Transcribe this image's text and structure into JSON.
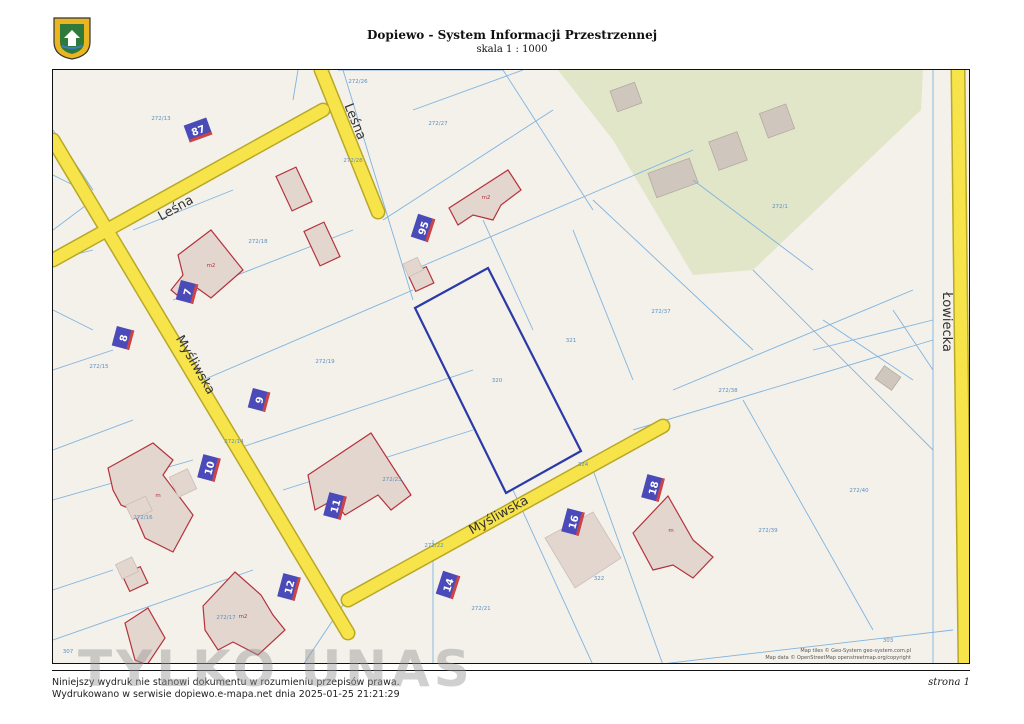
{
  "header": {
    "title": "Dopiewo - System Informacji Przestrzennej",
    "scale": "skala 1 : 1000"
  },
  "map": {
    "streets": [
      "Leśna",
      "Leśna",
      "Myśliwska",
      "Myśliwska",
      "Łowiecka"
    ],
    "address_numbers": [
      "87",
      "95",
      "7",
      "8",
      "9",
      "10",
      "11",
      "12",
      "14",
      "16",
      "18"
    ],
    "parcel_ids": [
      "272/26",
      "272/13",
      "272/27",
      "272/28",
      "272/18",
      "272/1",
      "272/15",
      "272/19",
      "321",
      "320",
      "272/37",
      "272/38",
      "272/14",
      "272/23",
      "272/40",
      "272/16",
      "272/22",
      "324",
      "272/39",
      "272/17",
      "272/21",
      "322",
      "307",
      "303"
    ],
    "building_labels": [
      "m2",
      "m2",
      "m",
      "m2",
      "m"
    ],
    "attribution": [
      "Map tiles © Geo-System geo-system.com.pl",
      "Map data © OpenStreetMap openstreetmap.org/copyright"
    ],
    "colors": {
      "background": "#f4f1ea",
      "road_fill": "#f7e34a",
      "road_casing": "#b9a826",
      "parcel_line": "#7fb4e0",
      "building_outline": "#b5323c",
      "building_fill": "#e2d6cf",
      "address_badge": "#4a4ab8",
      "highlight": "#2a3aa8",
      "green_area": "#e2e6c8"
    }
  },
  "footer": {
    "line1": "Niniejszy wydruk nie stanowi dokumentu w rozumieniu przepisów prawa.",
    "line2": "Wydrukowano w serwisie dopiewo.e-mapa.net dnia 2025-01-25 21:21:29",
    "page": "strona 1"
  },
  "watermark": "TYLKO UNAS"
}
